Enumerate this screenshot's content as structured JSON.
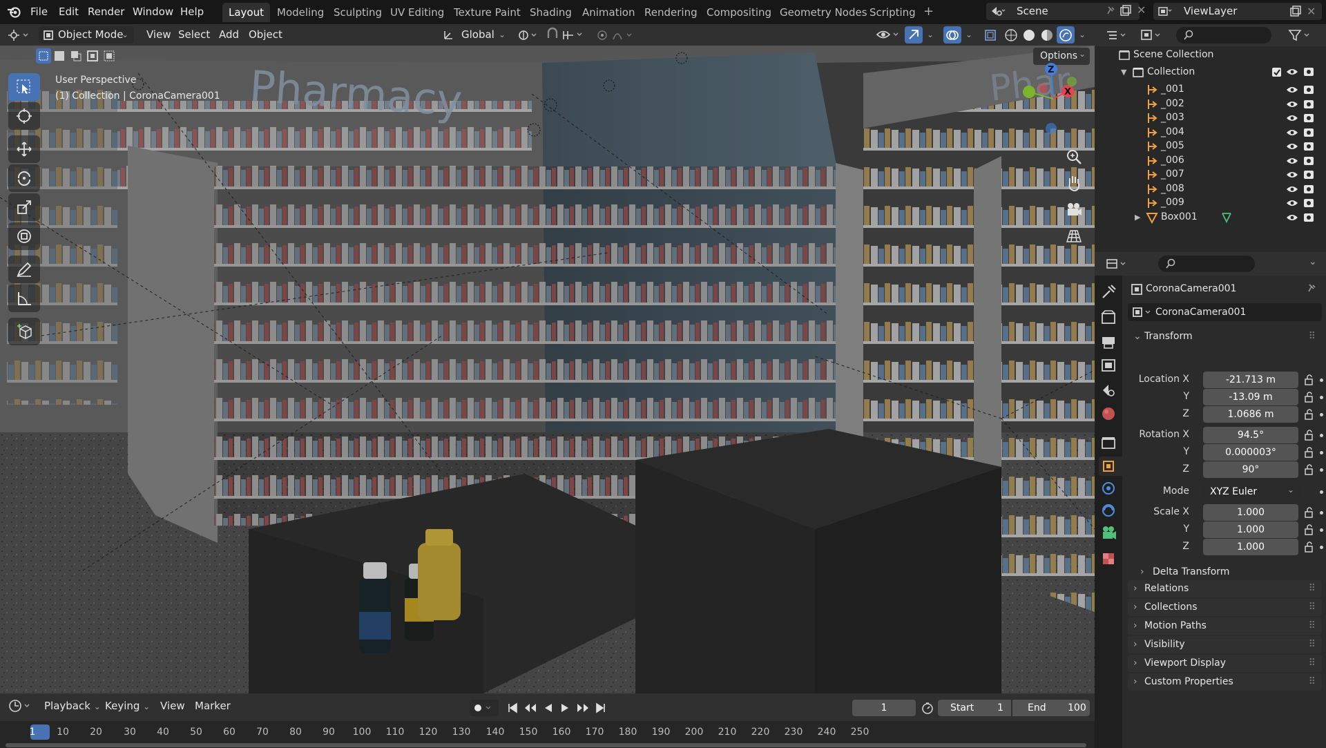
{
  "colors": {
    "accent": "#4772b3",
    "frame_active": "#4772b3",
    "axis_x": "#e8414f",
    "axis_y": "#7bb62a",
    "axis_z": "#3f7fe1"
  },
  "menus": [
    "File",
    "Edit",
    "Render",
    "Window",
    "Help"
  ],
  "workspaces": [
    "Layout",
    "Modeling",
    "Sculpting",
    "UV Editing",
    "Texture Paint",
    "Shading",
    "Animation",
    "Rendering",
    "Compositing",
    "Geometry Nodes",
    "Scripting"
  ],
  "active_workspace": "Layout",
  "scene": {
    "name": "Scene",
    "view_layer": "ViewLayer"
  },
  "viewport_header": {
    "mode": "Object Mode",
    "menu": [
      "View",
      "Select",
      "Add",
      "Object"
    ],
    "orientation": "Global",
    "options": "Options"
  },
  "viewport": {
    "perspective": "User Perspective",
    "context": "(1) Collection | CoronaCamera001",
    "sign_text": "Pharmacy",
    "sign_text_right": "Phar"
  },
  "timeline": {
    "menu": [
      "Playback",
      "Keying",
      "View",
      "Marker"
    ],
    "current_frame": "1",
    "start_label": "Start",
    "start": "1",
    "end_label": "End",
    "end": "100",
    "ticks": [
      "1",
      "10",
      "20",
      "30",
      "40",
      "50",
      "60",
      "70",
      "80",
      "90",
      "100",
      "110",
      "120",
      "130",
      "140",
      "150",
      "160",
      "170",
      "180",
      "190",
      "200",
      "210",
      "220",
      "230",
      "240",
      "250"
    ]
  },
  "outliner": {
    "root": "Scene Collection",
    "collection": "Collection",
    "items": [
      "_001",
      "_002",
      "_003",
      "_004",
      "_005",
      "_006",
      "_007",
      "_008",
      "_009",
      "Box001"
    ]
  },
  "properties": {
    "object_name": "CoronaCamera001",
    "datablock": "CoronaCamera001",
    "transform_label": "Transform",
    "location": {
      "label": "Location X",
      "x": "-21.713 m",
      "y": "-13.09 m",
      "z": "1.0686 m"
    },
    "rotation": {
      "label": "Rotation X",
      "x": "94.5°",
      "y": "0.000003°",
      "z": "90°"
    },
    "mode": {
      "label": "Mode",
      "value": "XYZ Euler"
    },
    "scale": {
      "label": "Scale X",
      "x": "1.000",
      "y": "1.000",
      "z": "1.000"
    },
    "axis_labels": {
      "y": "Y",
      "z": "Z"
    },
    "delta": "Delta Transform",
    "panels": [
      "Relations",
      "Collections",
      "Motion Paths",
      "Visibility",
      "Viewport Display",
      "Custom Properties"
    ]
  }
}
